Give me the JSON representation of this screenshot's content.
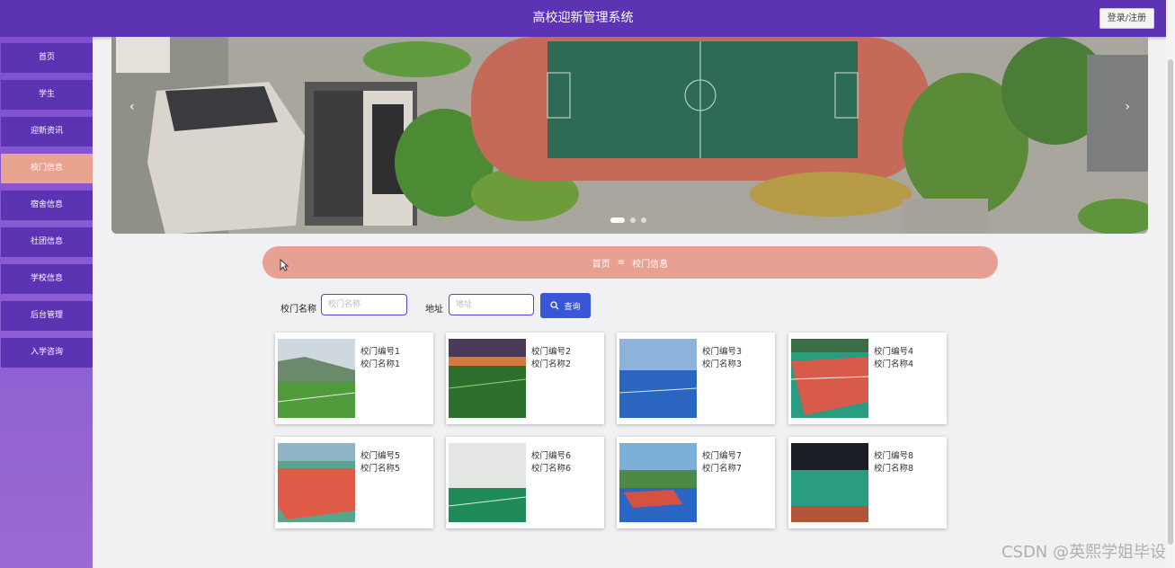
{
  "header": {
    "title": "高校迎新管理系统",
    "login_label": "登录/注册"
  },
  "sidebar": {
    "items": [
      {
        "label": "首页",
        "active": false
      },
      {
        "label": "学生",
        "active": false
      },
      {
        "label": "迎新资讯",
        "active": false
      },
      {
        "label": "校门信息",
        "active": true
      },
      {
        "label": "宿舍信息",
        "active": false
      },
      {
        "label": "社团信息",
        "active": false
      },
      {
        "label": "学校信息",
        "active": false
      },
      {
        "label": "后台管理",
        "active": false
      },
      {
        "label": "入学咨询",
        "active": false
      }
    ]
  },
  "banner": {
    "prev_arrow": "‹",
    "next_arrow": "›"
  },
  "breadcrumb": {
    "home": "首页",
    "separator": "≡",
    "current": "校门信息"
  },
  "search": {
    "name_label": "校门名称",
    "name_placeholder": "校门名称",
    "address_label": "地址",
    "address_placeholder": "地址",
    "query_label": "查询"
  },
  "cards": [
    {
      "line1": "校门编号1",
      "line2": "校门名称1"
    },
    {
      "line1": "校门编号2",
      "line2": "校门名称2"
    },
    {
      "line1": "校门编号3",
      "line2": "校门名称3"
    },
    {
      "line1": "校门编号4",
      "line2": "校门名称4"
    },
    {
      "line1": "校门编号5",
      "line2": "校门名称5"
    },
    {
      "line1": "校门编号6",
      "line2": "校门名称6"
    },
    {
      "line1": "校门编号7",
      "line2": "校门名称7"
    },
    {
      "line1": "校门编号8",
      "line2": "校门名称8"
    }
  ],
  "watermark": "CSDN @英熙学姐毕设",
  "colors": {
    "header": "#5b33b3",
    "active": "#e8a48f",
    "button": "#3a56d8",
    "crumb": "#e8a093"
  }
}
